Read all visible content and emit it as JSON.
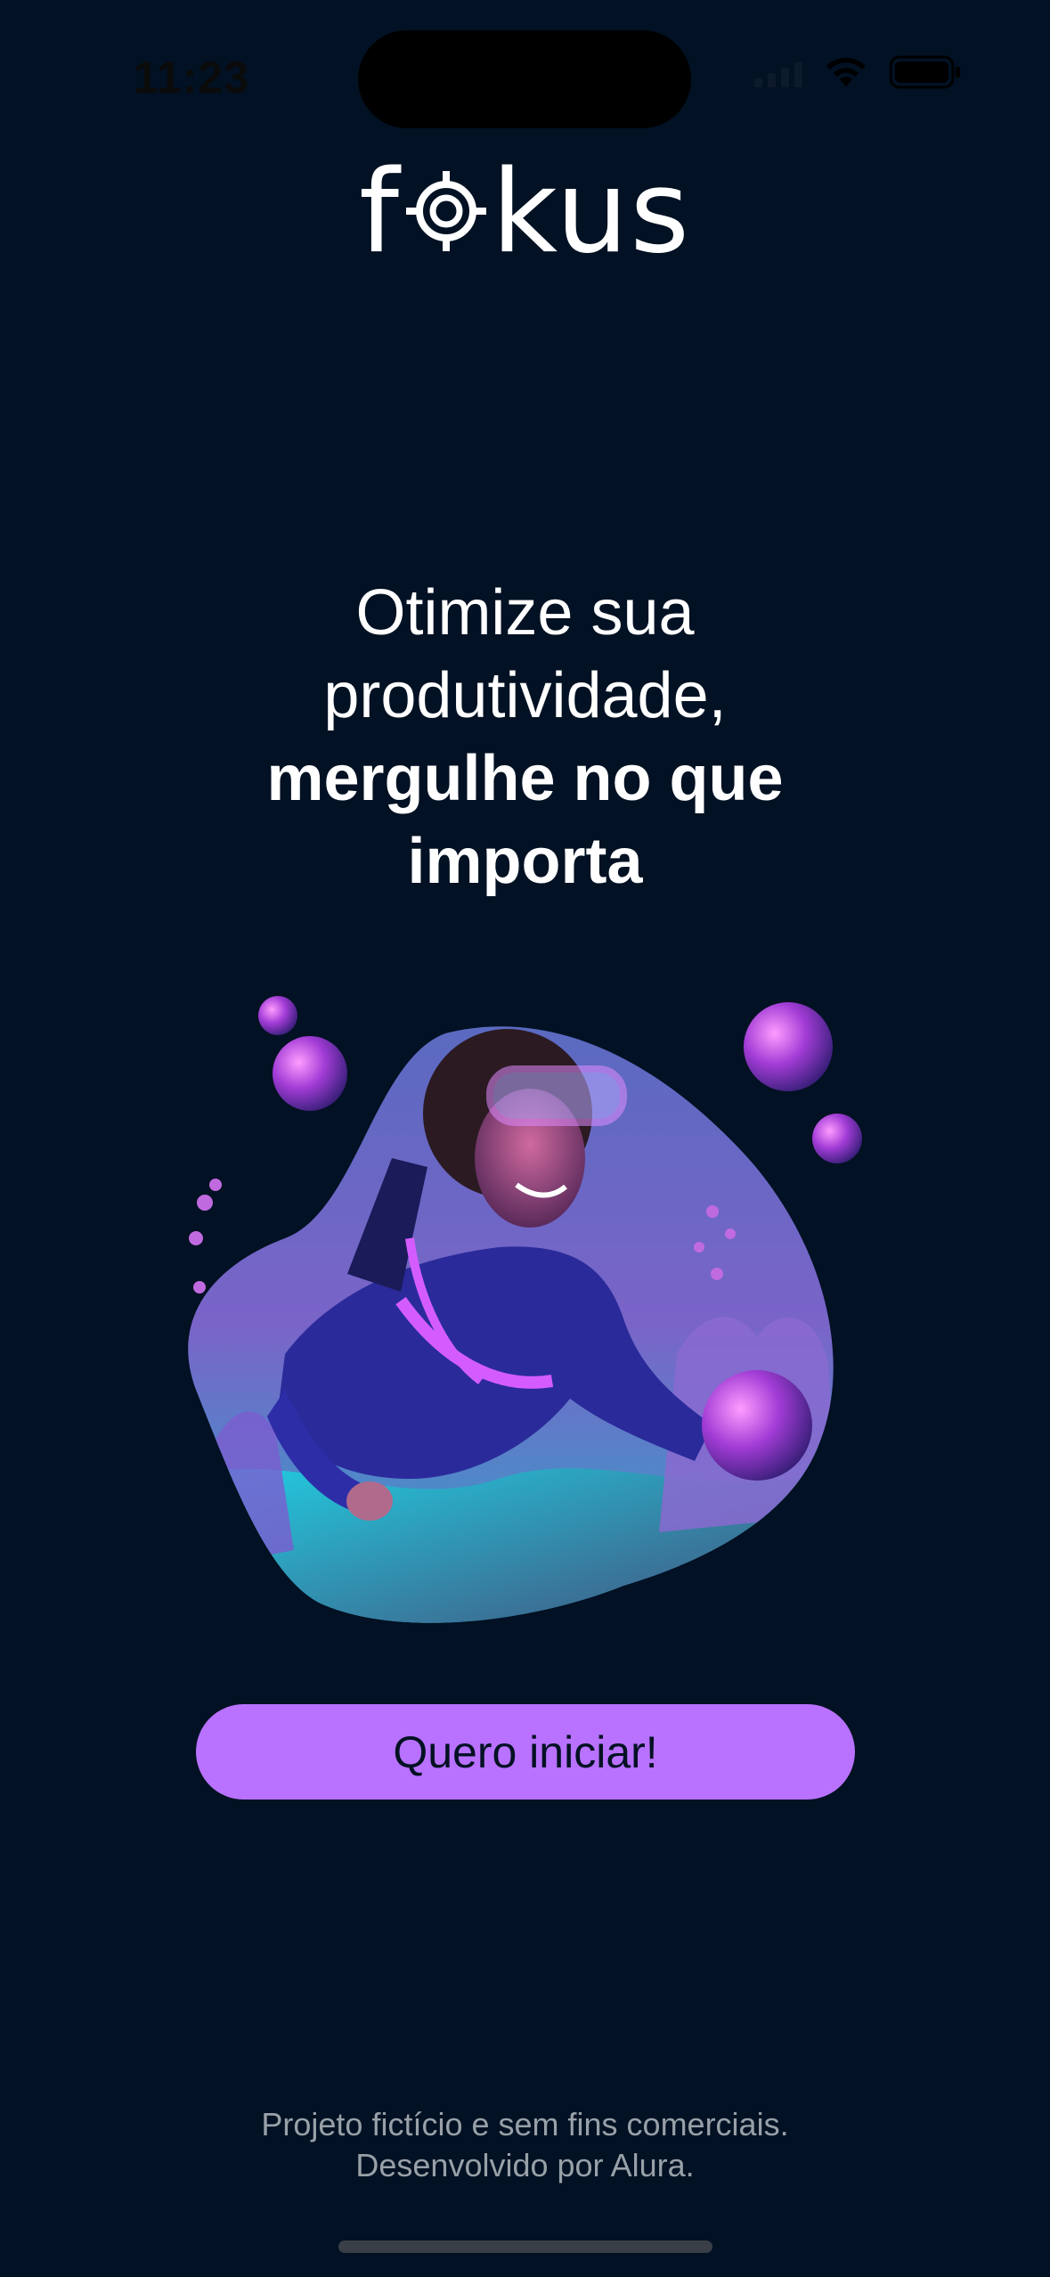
{
  "status_bar": {
    "time": "11:23",
    "icons": [
      "signal-icon",
      "wifi-icon",
      "battery-icon"
    ]
  },
  "app": {
    "logo_text_left": "f",
    "logo_text_right": "kus",
    "logo_name": "fokus"
  },
  "headline": {
    "line1": "Otimize sua",
    "line2": "produtividade,",
    "line3": "mergulhe no que",
    "line4": "importa"
  },
  "hero": {
    "image": "diver-illustration"
  },
  "cta": {
    "label": "Quero iniciar!"
  },
  "footer": {
    "line1": "Projeto fictício e sem fins comerciais.",
    "line2": "Desenvolvido por Alura."
  },
  "colors": {
    "background": "#021123",
    "accent": "#b872ff",
    "text": "#ffffff",
    "footer_text": "#98a0a8"
  }
}
